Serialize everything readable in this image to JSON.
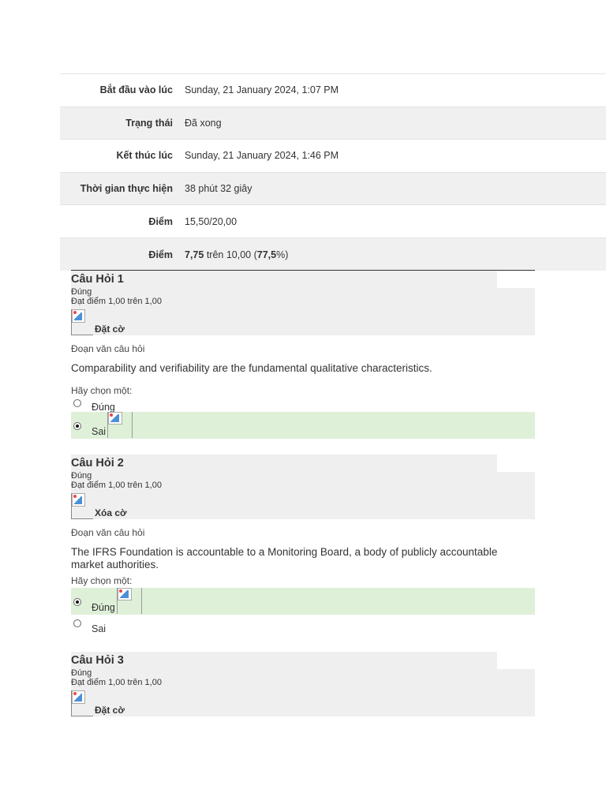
{
  "summary": [
    {
      "label": "Bắt đầu vào lúc",
      "value": "Sunday, 21 January 2024, 1:07 PM"
    },
    {
      "label": "Trạng thái",
      "value": "Đã xong"
    },
    {
      "label": "Kết thúc lúc",
      "value": "Sunday, 21 January 2024, 1:46 PM"
    },
    {
      "label": "Thời gian thực hiện",
      "value": "38 phút 32 giây"
    },
    {
      "label": "Điểm",
      "value": "15,50/20,00"
    },
    {
      "label": "Điểm",
      "value_bold1": "7,75",
      "value_mid": " trên 10,00 (",
      "value_bold2": "77,5",
      "value_end": "%)"
    }
  ],
  "questions": [
    {
      "title": "Câu Hỏi 1",
      "state": "Đúng",
      "grade": "Đạt điểm 1,00 trên 1,00",
      "flag_label": "Đặt cờ",
      "text_label": "Đoạn văn câu hỏi",
      "text": "Comparability and verifiability are the fundamental qualitative characteristics.",
      "prompt": "Hãy chọn một:",
      "options": [
        {
          "label": "Đúng",
          "selected": false
        },
        {
          "label": "Sai",
          "selected": true
        }
      ]
    },
    {
      "title": "Câu Hỏi 2",
      "state": "Đúng",
      "grade": "Đạt điểm 1,00 trên 1,00",
      "flag_label": "Xóa cờ",
      "text_label": "Đoạn văn câu hỏi",
      "text": "The IFRS Foundation is accountable to a Monitoring Board, a body of publicly accountable market authorities.",
      "prompt": "Hãy chọn một:",
      "options": [
        {
          "label": "Đúng",
          "selected": true
        },
        {
          "label": "Sai",
          "selected": false
        }
      ]
    },
    {
      "title": "Câu Hỏi 3",
      "state": "Đúng",
      "grade": "Đạt điểm 1,00 trên 1,00",
      "flag_label": "Đặt cờ"
    }
  ],
  "icons": {
    "flag": "broken-image-icon",
    "feedback": "broken-image-icon",
    "radio": "radio-icon"
  },
  "colors": {
    "selected_bg": "#dff0d8",
    "info_bg": "#efefef",
    "alt_row_bg": "#f0f0f0"
  }
}
